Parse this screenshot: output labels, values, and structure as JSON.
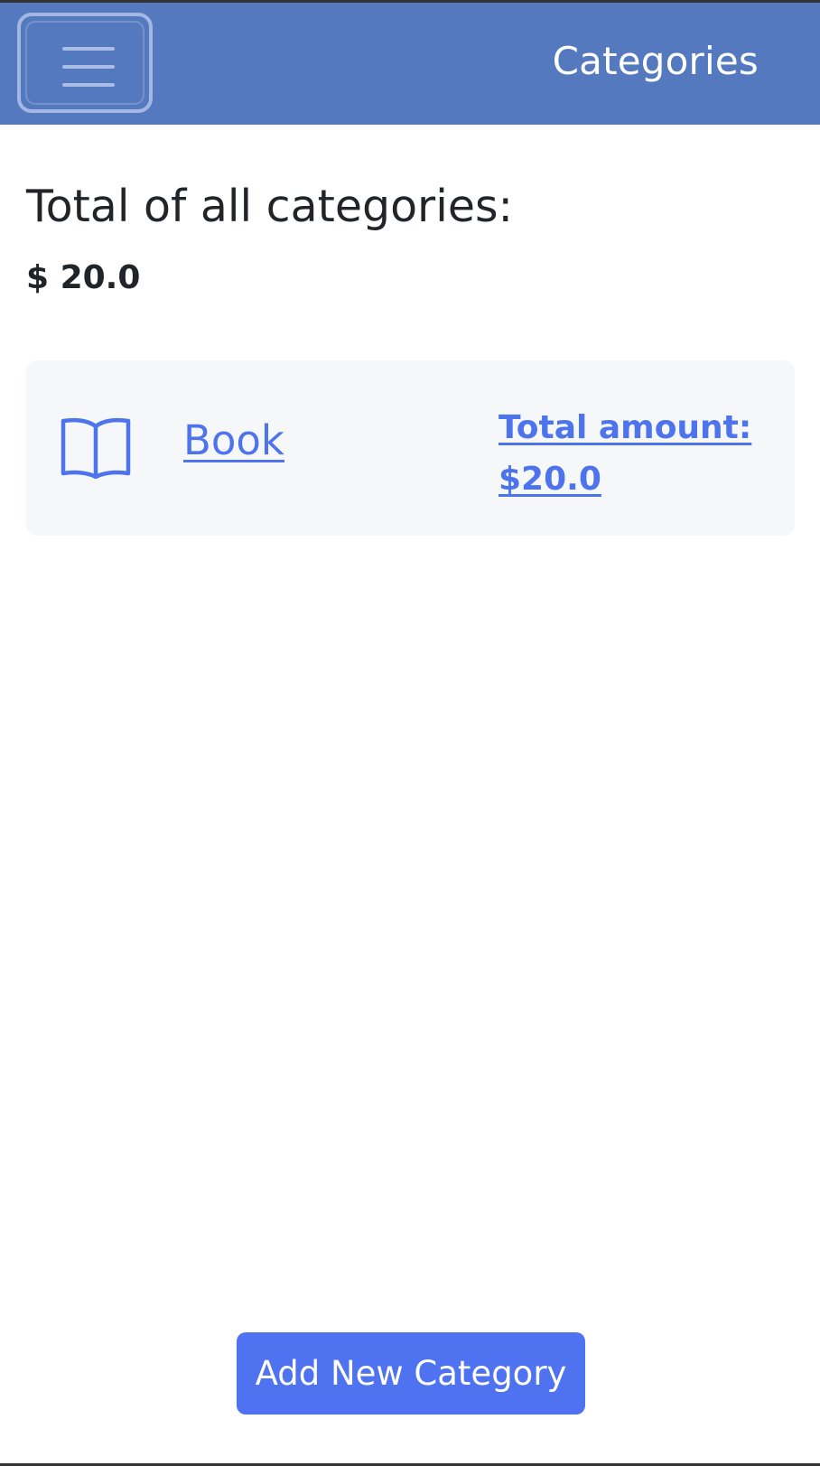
{
  "navbar": {
    "title": "Categories",
    "menu_icon": "hamburger-menu-icon",
    "background_color": "#5479be"
  },
  "summary": {
    "heading": "Total of all categories:",
    "value": "$ 20.0"
  },
  "categories": [
    {
      "icon": "book-icon",
      "name": "Book",
      "total_label": "Total amount:",
      "total_value": "$20.0"
    }
  ],
  "actions": {
    "add_category_label": "Add New Category",
    "button_color": "#4f73f0"
  },
  "colors": {
    "link": "#4d74ec",
    "card_background": "#f6f7f9",
    "text": "#212529"
  }
}
